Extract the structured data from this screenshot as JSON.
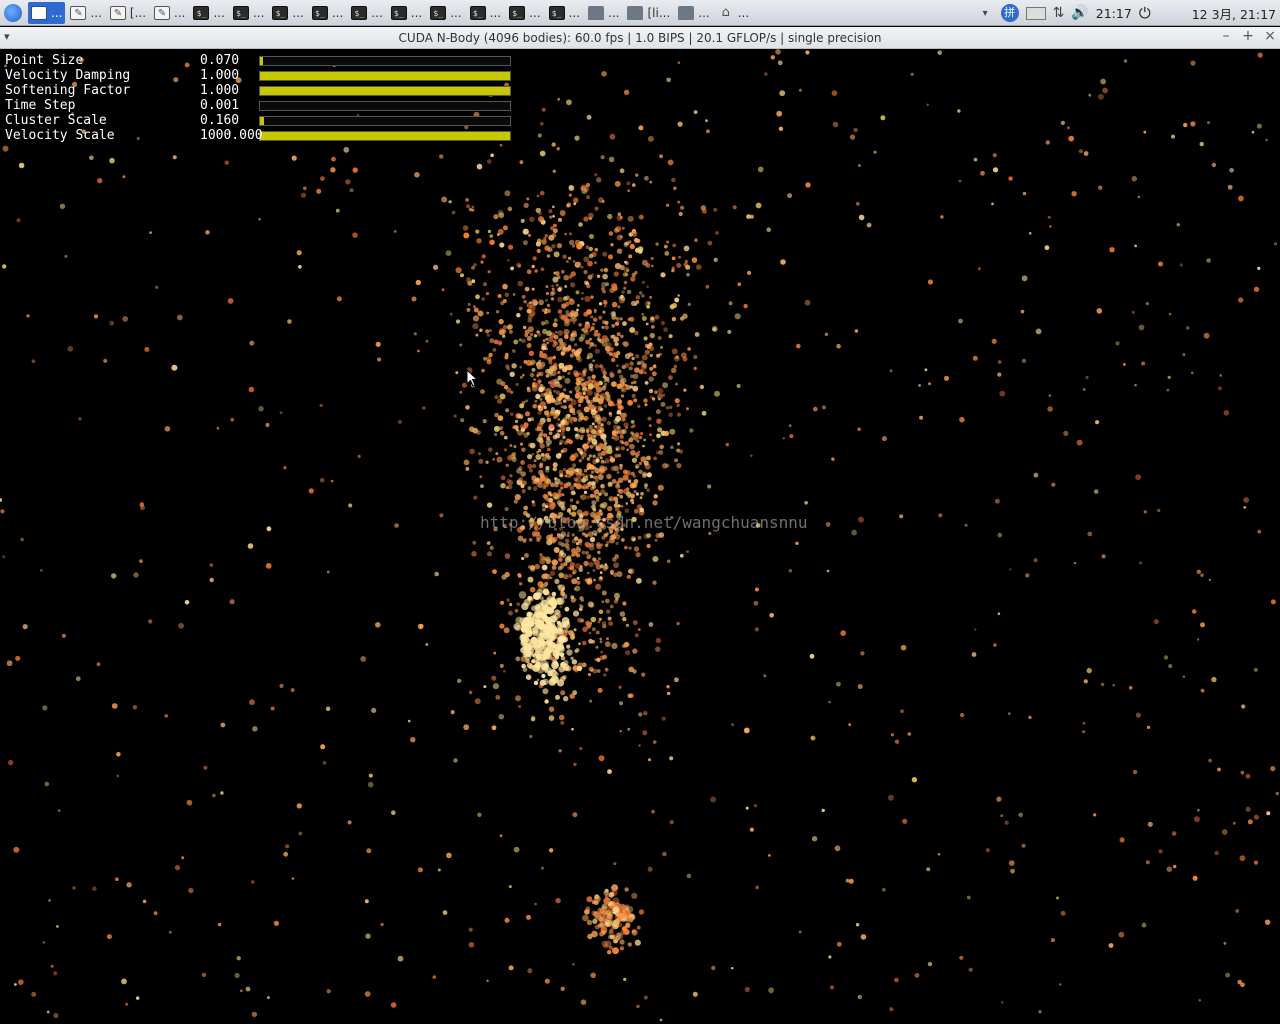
{
  "taskbar": {
    "tasks": [
      {
        "icon": "window-icon",
        "label": "...",
        "active": true
      },
      {
        "icon": "text-editor-icon",
        "label": "..."
      },
      {
        "icon": "text-editor-icon",
        "label": "[..."
      },
      {
        "icon": "text-editor-icon",
        "label": "..."
      },
      {
        "icon": "terminal-icon",
        "label": "..."
      },
      {
        "icon": "terminal-icon",
        "label": "..."
      },
      {
        "icon": "terminal-icon",
        "label": "..."
      },
      {
        "icon": "terminal-icon",
        "label": "..."
      },
      {
        "icon": "terminal-icon",
        "label": "..."
      },
      {
        "icon": "terminal-icon",
        "label": "..."
      },
      {
        "icon": "terminal-icon",
        "label": "..."
      },
      {
        "icon": "terminal-icon",
        "label": "..."
      },
      {
        "icon": "terminal-icon",
        "label": "..."
      },
      {
        "icon": "terminal-icon",
        "label": "..."
      },
      {
        "icon": "folder-icon",
        "label": "..."
      },
      {
        "icon": "folder-icon",
        "label": "[li..."
      },
      {
        "icon": "folder-icon",
        "label": "..."
      },
      {
        "icon": "home-folder-icon",
        "label": "..."
      }
    ],
    "tray": {
      "dropdown": "▾",
      "clock": "21:17",
      "date": "12 3月, 21:17"
    }
  },
  "window": {
    "title": "CUDA N-Body (4096 bodies): 60.0 fps | 1.0 BIPS | 20.1 GFLOP/s | single precision",
    "menu_glyph": "▾",
    "minimize": "–",
    "maximize": "+",
    "close": "×"
  },
  "params": [
    {
      "name": "Point Size",
      "value": "0.070",
      "fraction": 0.01
    },
    {
      "name": "Velocity Damping",
      "value": "1.000",
      "fraction": 1.0
    },
    {
      "name": "Softening Factor",
      "value": "1.000",
      "fraction": 1.0
    },
    {
      "name": "Time Step",
      "value": "0.001",
      "fraction": 0.0
    },
    {
      "name": "Cluster Scale",
      "value": "0.160",
      "fraction": 0.016
    },
    {
      "name": "Velocity Scale",
      "value": "1000.000",
      "fraction": 1.0
    }
  ],
  "watermark": "http://blog.csdn.net/wangchuansnnu",
  "colors": {
    "slider_fill": "#c8c800",
    "particle_warm": "#ff8a3c",
    "particle_bright": "#ffe6a0",
    "active_task": "#2d6bd2"
  }
}
